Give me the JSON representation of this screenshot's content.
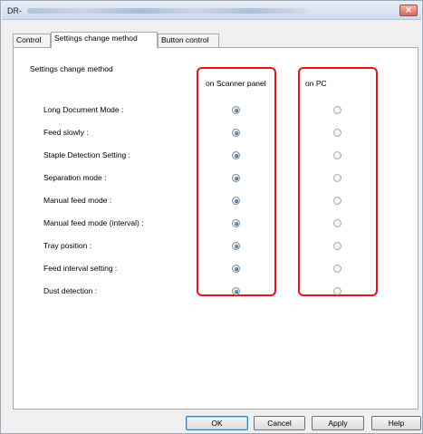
{
  "window": {
    "title_prefix": "DR-",
    "close_glyph": "✕"
  },
  "tabs": [
    {
      "label": "Control"
    },
    {
      "label": "Settings change method"
    },
    {
      "label": "Button control"
    }
  ],
  "section": {
    "title": "Settings change method",
    "col_scanner": "on Scanner panel",
    "col_pc": "on PC"
  },
  "rows": [
    {
      "label": "Long Document Mode :",
      "selected": "scanner"
    },
    {
      "label": "Feed slowly :",
      "selected": "scanner"
    },
    {
      "label": "Staple Detection Setting :",
      "selected": "scanner"
    },
    {
      "label": "Separation mode :",
      "selected": "scanner"
    },
    {
      "label": "Manual feed mode :",
      "selected": "scanner"
    },
    {
      "label": "Manual feed mode (interval) :",
      "selected": "scanner"
    },
    {
      "label": "Tray position :",
      "selected": "scanner"
    },
    {
      "label": "Feed interval setting :",
      "selected": "scanner"
    },
    {
      "label": "Dust detection :",
      "selected": "scanner"
    }
  ],
  "buttons": {
    "ok": "OK",
    "cancel": "Cancel",
    "apply": "Apply",
    "help": "Help"
  },
  "colors": {
    "highlight_box": "#e0141a",
    "radio_selected": "#1e5fa3"
  }
}
